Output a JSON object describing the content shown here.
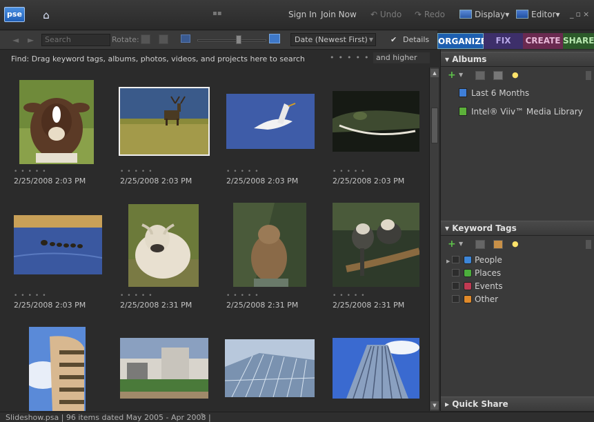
{
  "app": {
    "logo": "pse",
    "sign_in": "Sign In",
    "join_now": "Join Now",
    "undo": "Undo",
    "redo": "Redo",
    "display": "Display",
    "editor": "Editor"
  },
  "toolbar": {
    "search_placeholder": "Search",
    "rotate_label": "Rotate:",
    "sort": "Date (Newest First)",
    "details_label": "Details",
    "details_checked": true
  },
  "tabs": [
    "ORGANIZE",
    "FIX",
    "CREATE",
    "SHARE"
  ],
  "find": {
    "text": "Find: Drag keyword tags, albums, photos, videos, and projects here to search",
    "rating_filter": "and higher"
  },
  "photos": [
    {
      "id": "cow-brown",
      "date": "2/25/2008 2:03 PM",
      "selected": false
    },
    {
      "id": "deer",
      "date": "2/25/2008 2:03 PM",
      "selected": true
    },
    {
      "id": "egret",
      "date": "2/25/2008 2:03 PM",
      "selected": false
    },
    {
      "id": "alligator",
      "date": "2/25/2008 2:03 PM",
      "selected": false
    },
    {
      "id": "ducks",
      "date": "2/25/2008 2:03 PM",
      "selected": false
    },
    {
      "id": "cow-white",
      "date": "2/25/2008 2:31 PM",
      "selected": false
    },
    {
      "id": "groundhog",
      "date": "2/25/2008 2:31 PM",
      "selected": false
    },
    {
      "id": "monkeys",
      "date": "2/25/2008 2:31 PM",
      "selected": false
    },
    {
      "id": "tower",
      "date": "",
      "selected": false
    },
    {
      "id": "building-low",
      "date": "",
      "selected": false
    },
    {
      "id": "glass-dome",
      "date": "",
      "selected": false
    },
    {
      "id": "skyscraper",
      "date": "",
      "selected": false
    }
  ],
  "status": "Slideshow.psa | 96 items dated May 2005 - Apr 2008 |",
  "albums": {
    "title": "Albums",
    "items": [
      {
        "label": "Last 6 Months",
        "color": "#3f7fd8"
      },
      {
        "label": "Intel® Viiv™ Media Library",
        "color": "#5cb03a"
      }
    ]
  },
  "keywords": {
    "title": "Keyword Tags",
    "items": [
      {
        "label": "People",
        "color": "#3d86d8"
      },
      {
        "label": "Places",
        "color": "#4cae3c"
      },
      {
        "label": "Events",
        "color": "#c03a52"
      },
      {
        "label": "Other",
        "color": "#e08a2a"
      }
    ]
  },
  "quick_share": {
    "title": "Quick Share"
  }
}
